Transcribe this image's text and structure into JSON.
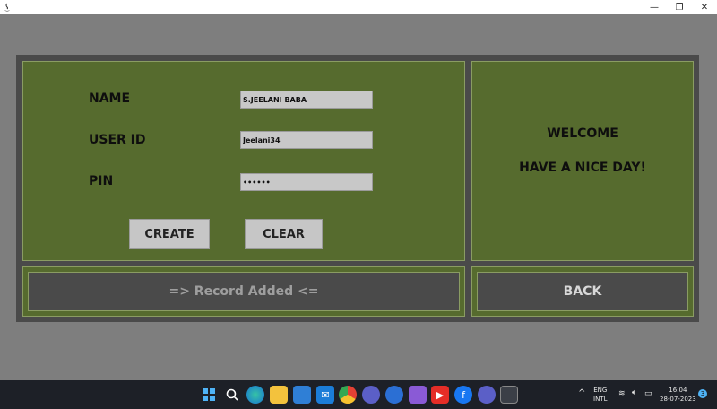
{
  "window": {
    "minimize_glyph": "—",
    "maximize_glyph": "❐",
    "close_glyph": "✕"
  },
  "form": {
    "name_label": "NAME",
    "name_value": "S.JEELANI BABA",
    "userid_label": "USER ID",
    "userid_value": "Jeelani34",
    "pin_label": "PIN",
    "pin_value": "••••••",
    "create_label": "CREATE",
    "clear_label": "CLEAR"
  },
  "welcome": {
    "line1": "WELCOME",
    "line2": "HAVE A NICE DAY!"
  },
  "status": {
    "message": "=> Record Added <="
  },
  "back": {
    "label": "BACK"
  },
  "colors": {
    "panel_green": "#566b2e",
    "panel_border": "#8a9c63",
    "dark_gray": "#4a4a4a",
    "background": "#7e7e7e",
    "status_text": "#9e9e9e",
    "back_text": "#d8d8d8"
  },
  "taskbar": {
    "icons": [
      "windows-start-icon",
      "search-icon",
      "edge-icon",
      "file-explorer-icon",
      "store-icon",
      "mail-icon",
      "chrome-icon",
      "app-icon",
      "app-icon",
      "app-icon",
      "youtube-icon",
      "facebook-icon",
      "app-icon",
      "java-app-icon"
    ],
    "chevron": "^",
    "lang_line1": "ENG",
    "lang_line2": "INTL",
    "time": "16:04",
    "date": "28-07-2023",
    "notification_count": "3"
  }
}
